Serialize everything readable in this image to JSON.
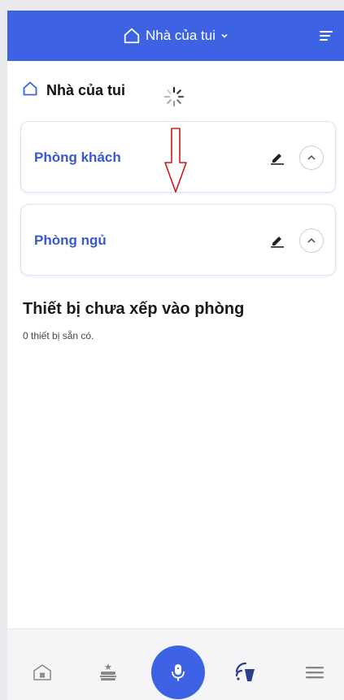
{
  "header": {
    "title": "Nhà của tui",
    "home_icon": "home-icon",
    "dropdown_icon": "chevron-down-icon",
    "menu_icon": "menu-icon"
  },
  "home": {
    "label": "Nhà của tui",
    "loading": true
  },
  "rooms": [
    {
      "name": "Phòng khách"
    },
    {
      "name": "Phòng ngủ"
    }
  ],
  "unassigned": {
    "title": "Thiết bị chưa xếp vào phòng",
    "subtitle": "0 thiết bị sẵn có."
  },
  "bottom_nav": [
    {
      "icon": "home-icon"
    },
    {
      "icon": "cake-icon"
    },
    {
      "icon": "microphone-icon"
    },
    {
      "icon": "wireless-icon"
    },
    {
      "icon": "menu-icon"
    }
  ],
  "colors": {
    "accent": "#3d63e4",
    "room_text": "#3559d4",
    "annotation_arrow": "#d0181b"
  }
}
